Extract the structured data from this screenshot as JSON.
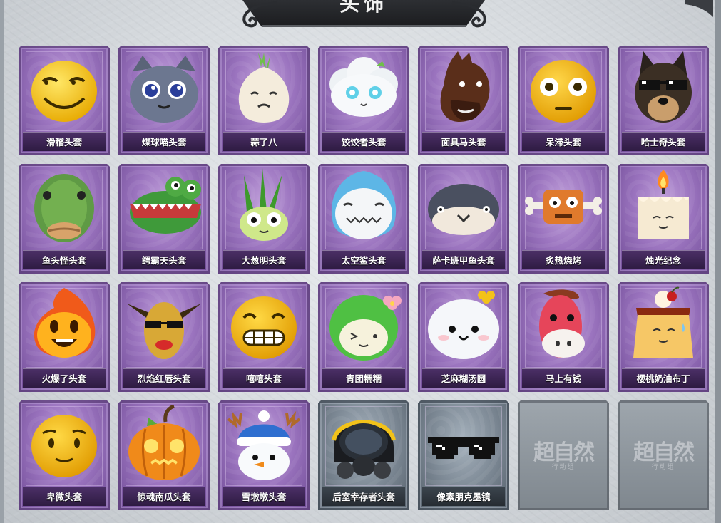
{
  "header": {
    "title": "头饰"
  },
  "items": [
    {
      "name": "滑稽头套",
      "tier": "purple",
      "icon": "funny-smiley-mask-icon"
    },
    {
      "name": "煤球喵头套",
      "tier": "purple",
      "icon": "grey-cat-mask-icon"
    },
    {
      "name": "蒜了八",
      "tier": "purple",
      "icon": "garlic-mask-icon"
    },
    {
      "name": "饺饺者头套",
      "tier": "purple",
      "icon": "cloud-dumpling-mask-icon"
    },
    {
      "name": "面具马头套",
      "tier": "purple",
      "icon": "horse-mask-icon"
    },
    {
      "name": "呆滞头套",
      "tier": "purple",
      "icon": "dazed-smiley-mask-icon"
    },
    {
      "name": "哈士奇头套",
      "tier": "purple",
      "icon": "husky-sunglasses-mask-icon"
    },
    {
      "name": "鱼头怪头套",
      "tier": "purple",
      "icon": "fish-head-mask-icon"
    },
    {
      "name": "鳄霸天头套",
      "tier": "purple",
      "icon": "crocodile-mask-icon"
    },
    {
      "name": "大葱明头套",
      "tier": "purple",
      "icon": "scallion-mask-icon"
    },
    {
      "name": "太空鲨头套",
      "tier": "purple",
      "icon": "space-shark-mask-icon"
    },
    {
      "name": "萨卡班甲鱼头套",
      "tier": "purple",
      "icon": "sacabambaspis-mask-icon"
    },
    {
      "name": "炙热烧烤",
      "tier": "purple",
      "icon": "barbecue-mask-icon"
    },
    {
      "name": "烛光纪念",
      "tier": "purple",
      "icon": "candle-mask-icon"
    },
    {
      "name": "火爆了头套",
      "tier": "purple",
      "icon": "fire-spirit-mask-icon"
    },
    {
      "name": "烈焰红唇头套",
      "tier": "purple",
      "icon": "red-lips-pikachu-mask-icon"
    },
    {
      "name": "嘻嘻头套",
      "tier": "purple",
      "icon": "grinning-smiley-mask-icon"
    },
    {
      "name": "青团糯糯",
      "tier": "purple",
      "icon": "green-rice-ball-mask-icon"
    },
    {
      "name": "芝麻糊汤圆",
      "tier": "purple",
      "icon": "sesame-dumpling-mask-icon"
    },
    {
      "name": "马上有钱",
      "tier": "purple",
      "icon": "red-horse-mask-icon"
    },
    {
      "name": "樱桃奶油布丁",
      "tier": "purple",
      "icon": "cherry-pudding-mask-icon"
    },
    {
      "name": "卑微头套",
      "tier": "purple",
      "icon": "humble-smiley-mask-icon"
    },
    {
      "name": "惊魂南瓜头套",
      "tier": "purple",
      "icon": "pumpkin-mask-icon"
    },
    {
      "name": "雪墩墩头套",
      "tier": "purple",
      "icon": "snowman-mask-icon"
    },
    {
      "name": "后室幸存者头套",
      "tier": "grey",
      "icon": "gas-mask-helmet-icon"
    },
    {
      "name": "像素朋克墨镜",
      "tier": "grey",
      "icon": "pixel-sunglasses-icon"
    },
    {
      "name": "",
      "tier": "locked",
      "logo": "超自然",
      "sub": "行动组"
    },
    {
      "name": "",
      "tier": "locked",
      "logo": "超自然",
      "sub": "行动组"
    }
  ],
  "colors": {
    "purple_frame": "#9b74bf",
    "label_bar": "#2e1b42",
    "grey_frame": "#7d8995",
    "locked_frame": "#8e969d",
    "background": "#d6dade"
  }
}
